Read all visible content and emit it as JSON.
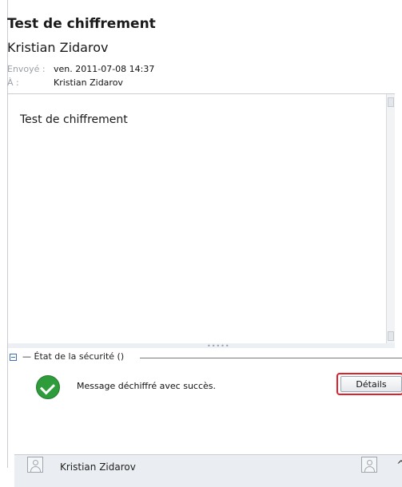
{
  "message": {
    "subject": "Test de chiffrement",
    "sender": "Kristian Zidarov",
    "sent_label": "Envoyé :",
    "sent_value": "ven. 2011-07-08 14:37",
    "to_label": "À :",
    "to_value": "Kristian Zidarov",
    "body": "Test de chiffrement"
  },
  "security": {
    "title": "— État de la sécurité ()",
    "status_message": "Message déchiffré avec succès.",
    "details_button": "Détails",
    "status_color": "#2e9c3a"
  },
  "footer": {
    "contact_name": "Kristian Zidarov"
  },
  "colors": {
    "highlight": "#e0202a"
  }
}
